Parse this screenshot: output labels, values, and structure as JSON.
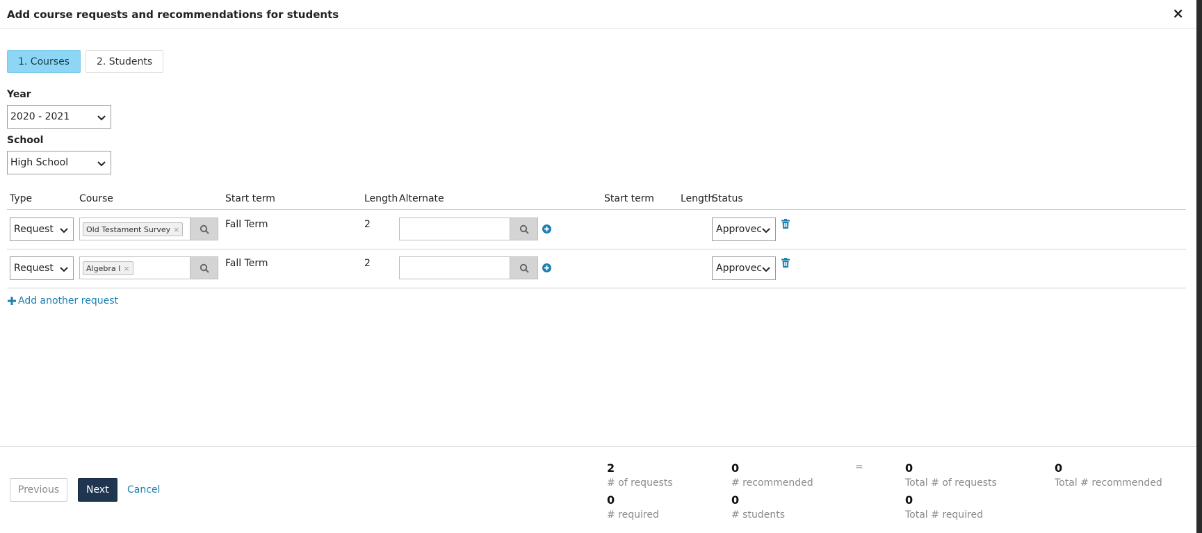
{
  "modal": {
    "title": "Add course requests and recommendations for students",
    "close_label": "×"
  },
  "steps": [
    {
      "label": "1. Courses",
      "active": true
    },
    {
      "label": "2. Students",
      "active": false
    }
  ],
  "form": {
    "year_label": "Year",
    "year_value": "2020 - 2021",
    "school_label": "School",
    "school_value": "High School"
  },
  "table": {
    "headers": {
      "type": "Type",
      "course": "Course",
      "start_term": "Start term",
      "length": "Length",
      "alternate": "Alternate",
      "alt_start_term": "Start term",
      "alt_length": "Length",
      "status": "Status"
    },
    "rows": [
      {
        "type": "Request",
        "course_tag": "Old Testament Survey",
        "start_term": "Fall Term",
        "length": "2",
        "alternate": "",
        "status": "Approvec"
      },
      {
        "type": "Request",
        "course_tag": "Algebra I",
        "start_term": "Fall Term",
        "length": "2",
        "alternate": "",
        "status": "Approvec"
      }
    ]
  },
  "add_request_label": "Add another request",
  "footer": {
    "previous": "Previous",
    "next": "Next",
    "cancel": "Cancel",
    "equals": "=",
    "stats": {
      "requests": {
        "value": "2",
        "label": "# of requests"
      },
      "recommended": {
        "value": "0",
        "label": "# recommended"
      },
      "total_requests": {
        "value": "0",
        "label": "Total # of requests"
      },
      "total_recommended": {
        "value": "0",
        "label": "Total # recommended"
      },
      "required": {
        "value": "0",
        "label": "# required"
      },
      "students": {
        "value": "0",
        "label": "# students"
      },
      "total_required": {
        "value": "0",
        "label": "Total # required"
      }
    }
  },
  "colors": {
    "accent_blue": "#1c7fb0",
    "step_active_bg": "#8dd6f5",
    "next_btn_bg": "#1f3550"
  }
}
